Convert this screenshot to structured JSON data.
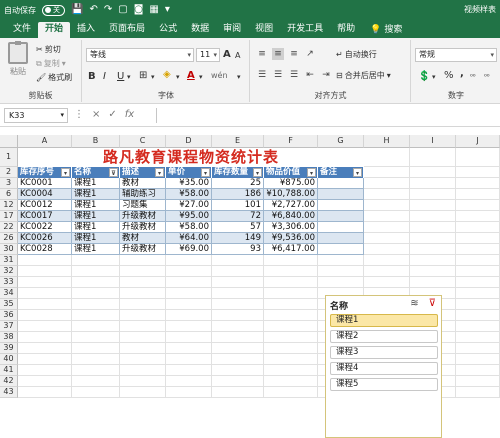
{
  "titlebar": {
    "autosave_label": "自动保存",
    "autosave_state": "关",
    "right_text": "视频样表"
  },
  "menu": {
    "tabs": [
      "文件",
      "开始",
      "插入",
      "页面布局",
      "公式",
      "数据",
      "审阅",
      "视图",
      "开发工具",
      "帮助"
    ],
    "active_index": 1,
    "search_label": "搜索"
  },
  "ribbon": {
    "clipboard": {
      "paste": "粘贴",
      "cut": "剪切",
      "copy": "复制",
      "format_painter": "格式刷",
      "label": "剪贴板"
    },
    "font": {
      "font_name": "等线",
      "font_size": "11",
      "bold": "B",
      "italic": "I",
      "underline": "U",
      "grow": "A",
      "shrink": "A",
      "wen": "wén",
      "label": "字体"
    },
    "alignment": {
      "wrap": "自动换行",
      "merge": "合并后居中",
      "label": "对齐方式"
    },
    "number": {
      "format": "常规",
      "currency": "%",
      "comma": ",",
      "label": "数字"
    }
  },
  "formula_bar": {
    "name_box": "K33",
    "cancel": "×",
    "enter": "✓",
    "fx": "fx",
    "content": ""
  },
  "sheet": {
    "columns": [
      "A",
      "B",
      "C",
      "D",
      "E",
      "F",
      "G",
      "H",
      "I",
      "J"
    ],
    "rows": [
      "1",
      "2",
      "3",
      "6",
      "12",
      "17",
      "22",
      "26",
      "30",
      "31",
      "32",
      "33",
      "34",
      "35",
      "36",
      "37",
      "38",
      "39",
      "40",
      "41",
      "42",
      "43"
    ],
    "title": "路凡教育课程物资统计表",
    "headers": [
      "库存序号",
      "名称",
      "描述",
      "单价",
      "库存数量",
      "物品价值",
      "备注"
    ],
    "data_rows": [
      [
        "KC0001",
        "课程1",
        "教材",
        "¥35.00",
        "25",
        "¥875.00",
        ""
      ],
      [
        "KC0004",
        "课程1",
        "辅助练习",
        "¥58.00",
        "186",
        "¥10,788.00",
        ""
      ],
      [
        "KC0012",
        "课程1",
        "习题集",
        "¥27.00",
        "101",
        "¥2,727.00",
        ""
      ],
      [
        "KC0017",
        "课程1",
        "升级教材",
        "¥95.00",
        "72",
        "¥6,840.00",
        ""
      ],
      [
        "KC0022",
        "课程1",
        "升级教材",
        "¥58.00",
        "57",
        "¥3,306.00",
        ""
      ],
      [
        "KC0026",
        "课程1",
        "教材",
        "¥64.00",
        "149",
        "¥9,536.00",
        ""
      ],
      [
        "KC0028",
        "课程1",
        "升级教材",
        "¥69.00",
        "93",
        "¥6,417.00",
        ""
      ]
    ]
  },
  "slicer": {
    "title": "名称",
    "items": [
      "课程1",
      "课程2",
      "课程3",
      "课程4",
      "课程5"
    ],
    "selected_index": 0
  }
}
